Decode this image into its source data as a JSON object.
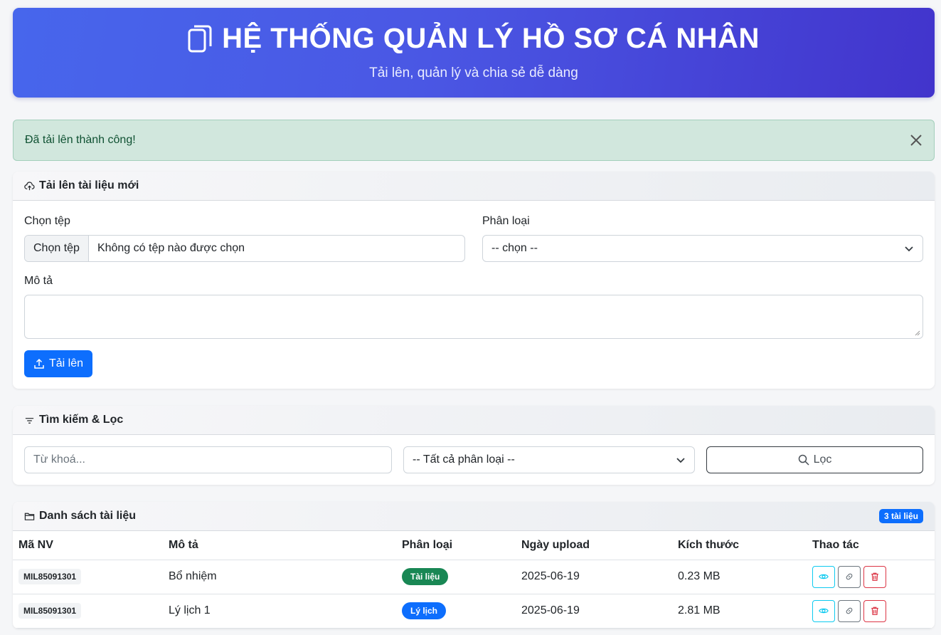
{
  "header": {
    "title": "HỆ THỐNG QUẢN LÝ HỒ SƠ CÁ NHÂN",
    "subtitle": "Tải lên, quản lý và chia sẻ dễ dàng"
  },
  "alert": {
    "message": "Đã tải lên thành công!"
  },
  "upload": {
    "title": "Tải lên tài liệu mới",
    "file_label": "Chọn tệp",
    "file_button": "Chọn tệp",
    "file_name": "Không có tệp nào được chọn",
    "category_label": "Phân loại",
    "category_value": "-- chọn --",
    "description_label": "Mô tả",
    "submit_label": "Tải lên"
  },
  "filter": {
    "title": "Tìm kiếm & Lọc",
    "keyword_placeholder": "Từ khoá...",
    "category_value": "-- Tất cả phân loại --",
    "button_label": "Lọc"
  },
  "documents": {
    "title": "Danh sách tài liệu",
    "count_badge": "3 tài liệu",
    "columns": {
      "code": "Mã NV",
      "description": "Mô tả",
      "category": "Phân loại",
      "date": "Ngày upload",
      "size": "Kích thước",
      "actions": "Thao tác"
    },
    "rows": [
      {
        "code": "MIL85091301",
        "description": "Bổ nhiệm",
        "category": "Tài liệu",
        "category_color": "#198754",
        "date": "2025-06-19",
        "size": "0.23 MB"
      },
      {
        "code": "MIL85091301",
        "description": "Lý lịch 1",
        "category": "Lý lịch",
        "category_color": "#0d6efd",
        "date": "2025-06-19",
        "size": "2.81 MB"
      }
    ]
  },
  "colors": {
    "primary": "#0d6efd",
    "success": "#198754",
    "info": "#0dcaf0",
    "danger": "#dc3545",
    "secondary": "#6c757d"
  },
  "icons": {
    "header": "files-icon",
    "upload": "cloud-upload-icon",
    "filter": "filter-icon",
    "documents": "folder-icon",
    "view": "eye-icon",
    "link": "link-icon",
    "delete": "trash-icon"
  }
}
